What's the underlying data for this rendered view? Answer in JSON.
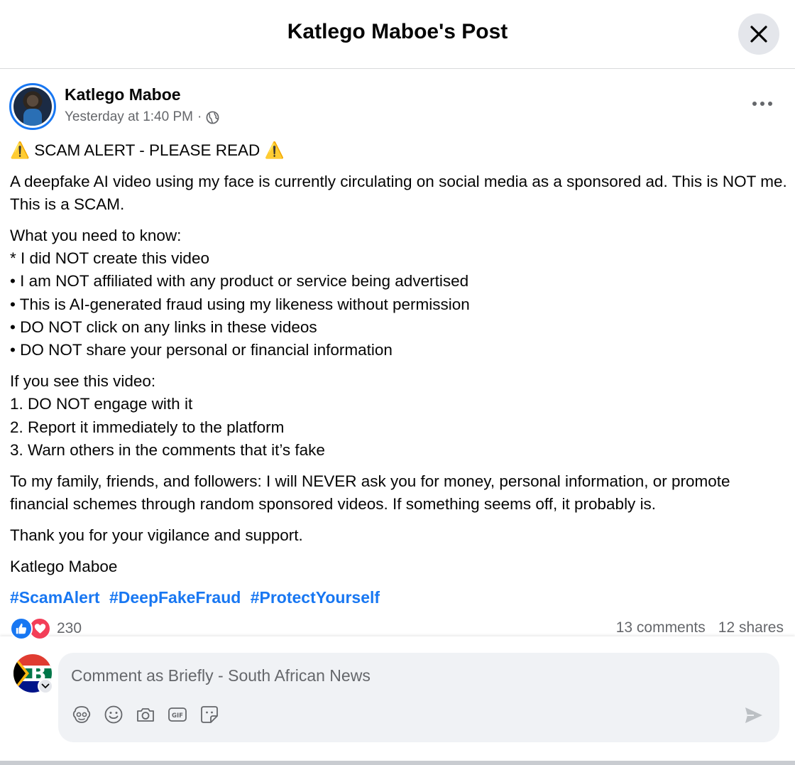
{
  "header": {
    "title": "Katlego Maboe's Post"
  },
  "post": {
    "author": "Katlego Maboe",
    "timestamp": "Yesterday at 1:40 PM",
    "separator": "·",
    "body": {
      "p1": "⚠️ SCAM ALERT - PLEASE READ ⚠️",
      "p2": "A deepfake AI video using my face is currently circulating on social media as a sponsored ad. This is NOT me. This is a SCAM.",
      "p3": [
        "What you need to know:",
        "* I did NOT create this video",
        "• I am NOT affiliated with any product or service being advertised",
        "• This is AI-generated fraud using my likeness without permission",
        "• DO NOT click on any links in these videos",
        "• DO NOT share your personal or financial information"
      ],
      "p4": [
        "If you see this video:",
        "1. DO NOT engage with it",
        "2. Report it immediately to the platform",
        "3. Warn others in the comments that it’s fake"
      ],
      "p5": "To my family, friends, and followers: I will NEVER ask you for money, personal information, or promote financial schemes through random sponsored videos. If something seems off, it probably is.",
      "p6": "Thank you for your vigilance and support.",
      "p7": "Katlego Maboe"
    },
    "hashtags": [
      "#ScamAlert",
      "#DeepFakeFraud",
      "#ProtectYourself"
    ],
    "reactions": {
      "count": "230",
      "icons": [
        "like-icon",
        "love-icon"
      ]
    },
    "comments_count": "13 comments",
    "shares_count": "12 shares"
  },
  "composer": {
    "placeholder": "Comment as Briefly - South African News",
    "tools": [
      "avatar-sticker-icon",
      "emoji-icon",
      "camera-icon",
      "gif-icon",
      "sticker-icon"
    ]
  },
  "colors": {
    "link": "#1877f2",
    "secondary_text": "#65676b",
    "like": "#1877f2",
    "love": "#f33e58",
    "input_bg": "#f0f2f5"
  }
}
